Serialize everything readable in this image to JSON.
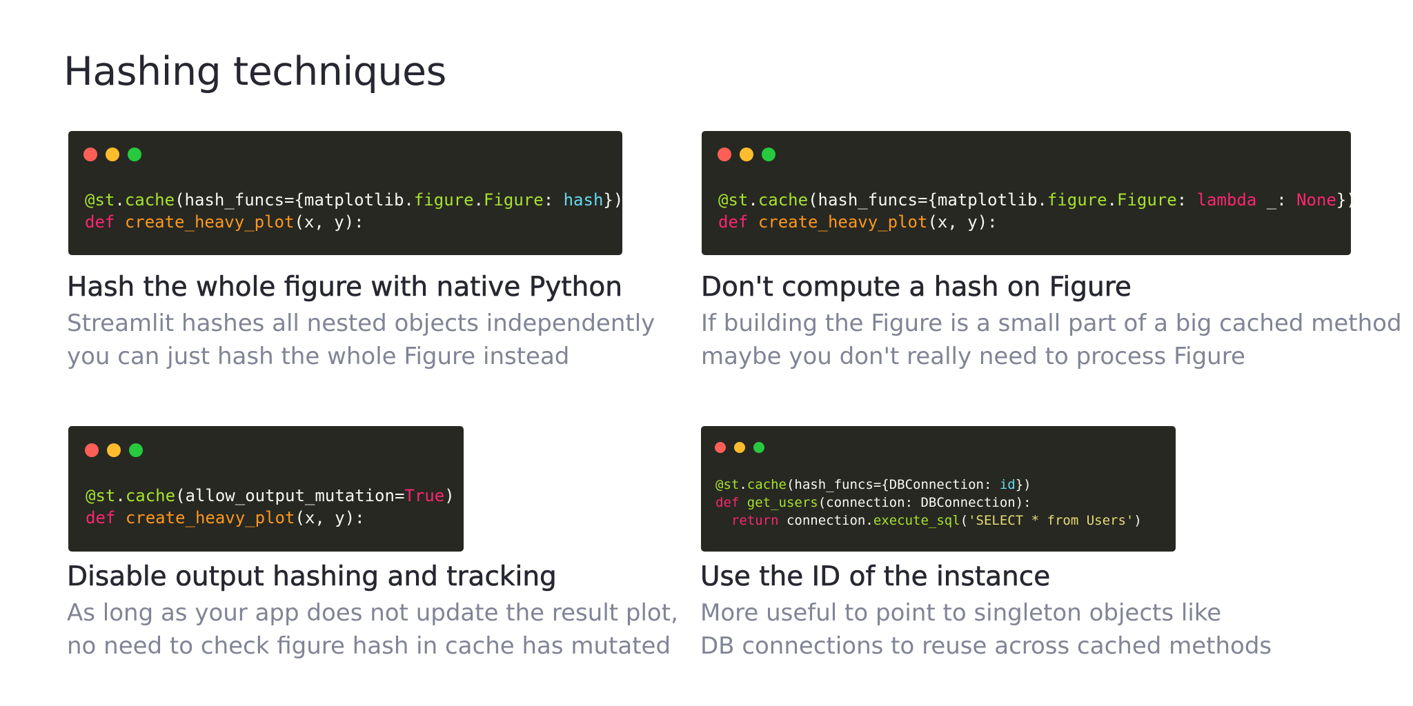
{
  "page": {
    "title": "Hashing techniques"
  },
  "cards": [
    {
      "title": "Hash the whole figure with native Python",
      "desc1": "Streamlit hashes all nested objects independently",
      "desc2": "you can just hash the whole Figure instead",
      "code": {
        "l1_dec": "@st",
        "l1_dot1": ".",
        "l1_cache": "cache",
        "l1_open": "(hash_funcs={matplotlib.",
        "l1_figure": "figure",
        "l1_dot2": ".",
        "l1_Figure": "Figure",
        "l1_colon": ": ",
        "l1_hash": "hash",
        "l1_close": "})",
        "l2_def": "def",
        "l2_fn": "create_heavy_plot",
        "l2_args": "(x, y):"
      }
    },
    {
      "title": "Don't compute a hash on Figure",
      "desc1": "If building the Figure is a small part of a big cached method",
      "desc2": "maybe you don't really need to process Figure",
      "code": {
        "l1_dec": "@st",
        "l1_dot1": ".",
        "l1_cache": "cache",
        "l1_open": "(hash_funcs={matplotlib.",
        "l1_figure": "figure",
        "l1_dot2": ".",
        "l1_Figure": "Figure",
        "l1_colon": ": ",
        "l1_lambda": "lambda",
        "l1_underscore": " _: ",
        "l1_none": "None",
        "l1_close": "})",
        "l2_def": "def",
        "l2_fn": "create_heavy_plot",
        "l2_args": "(x, y):"
      }
    },
    {
      "title": "Disable output hashing and tracking",
      "desc1": "As long as your app does not update the result plot,",
      "desc2": "no need to check figure hash in cache has mutated",
      "code": {
        "l1_dec": "@st",
        "l1_dot1": ".",
        "l1_cache": "cache",
        "l1_open": "(allow_output_mutation=",
        "l1_true": "True",
        "l1_close": ")",
        "l2_def": "def",
        "l2_fn": "create_heavy_plot",
        "l2_args": "(x, y):"
      }
    },
    {
      "title": "Use the ID of the instance",
      "desc1": "More useful to point to singleton objects like",
      "desc2": "DB connections to reuse across cached methods",
      "code": {
        "l1_dec": "@st",
        "l1_dot1": ".",
        "l1_cache": "cache",
        "l1_open": "(hash_funcs={DBConnection: ",
        "l1_id": "id",
        "l1_close": "})",
        "l2_def": "def",
        "l2_fn": "get_users",
        "l2_args": "(connection: DBConnection):",
        "l3_indent": "  ",
        "l3_return": "return",
        "l3_obj": " connection.",
        "l3_method": "execute_sql",
        "l3_open": "(",
        "l3_str": "'SELECT * from Users'",
        "l3_close": ")"
      }
    }
  ],
  "colors": {
    "code_bg": "#272822",
    "window_red": "#ff5f56",
    "window_yellow": "#ffbd2e",
    "window_green": "#27c93f",
    "title_text": "#262730",
    "desc_text": "#808495"
  }
}
